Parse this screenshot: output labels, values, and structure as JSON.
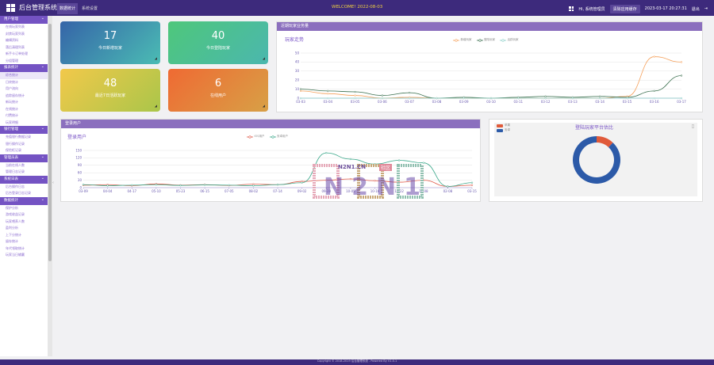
{
  "topbar": {
    "app_title": "后台管理系统",
    "tabs": [
      "数据统计",
      "系统设置"
    ],
    "welcome": "WELCOME! 2022-08-03",
    "user": "Hi, 系统管理员",
    "clear_cache": "清除应用缓存",
    "datetime": "2023-03-17 20:27:31",
    "logout": "退出"
  },
  "sidebar": [
    {
      "group": "用户管理",
      "items": [
        "在线玩家列表",
        "封禁玩家列表",
        "编辑资料",
        "落后清理列表",
        "新手卡订单处理",
        "分组管理"
      ]
    },
    {
      "group": "报表统计",
      "items": [
        "综合统计",
        "日终统计",
        "用户流向",
        "追踪留存统计",
        "新玩统计",
        "在线统计",
        "付费统计",
        "玩家明细"
      ]
    },
    {
      "group": "银行管理",
      "items": [
        "充值银行数据记录",
        "银行操作记录",
        "保险柜记录"
      ]
    },
    {
      "group": "管理员表",
      "items": [
        "当前在线人数",
        "管理日志记录"
      ]
    },
    {
      "group": "系统日表",
      "items": [
        "后台操作日志",
        "后台登录日志记录"
      ]
    },
    {
      "group": "数据统计",
      "items": [
        "保护分析",
        "游戏收益记录",
        "玩家喂养人数",
        "盈利分析",
        "上下分统计",
        "留存统计",
        "年代领取统计",
        "玩家当日输赢"
      ]
    }
  ],
  "stats": [
    {
      "value": "17",
      "label": "今日新增玩家",
      "from": "#3564a8",
      "to": "#4bbcb4"
    },
    {
      "value": "40",
      "label": "今日登陆玩家",
      "from": "#4ec77b",
      "to": "#4bb7ae"
    },
    {
      "value": "48",
      "label": "最近7日活跃玩家",
      "from": "#f2c84a",
      "to": "#aac64a"
    },
    {
      "value": "6",
      "label": "在线用户",
      "from": "#ef6a33",
      "to": "#d8a046"
    }
  ],
  "business": {
    "header": "近期玩家业务量",
    "title": "玩家走势",
    "legend": [
      {
        "name": "新增玩家",
        "color": "#f5a05a"
      },
      {
        "name": "登陆玩家",
        "color": "#3a6f4e"
      },
      {
        "name": "活跃玩家",
        "color": "#8ad0c8"
      }
    ]
  },
  "login_panel": {
    "header": "登录用户",
    "title": "登录用户",
    "legend": [
      {
        "name": "IOS用户",
        "color": "#e05a4a"
      },
      {
        "name": "安卓用户",
        "color": "#3aa88a"
      }
    ]
  },
  "platform": {
    "title": "登陆玩家平台估比",
    "legend": [
      {
        "name": "苹果",
        "color": "#e05a3a"
      },
      {
        "name": "安卓",
        "color": "#2c5aa8"
      }
    ],
    "ios_share": 0.12,
    "android_share": 0.88
  },
  "watermark": {
    "text": "N2N1.CN",
    "badge": "社区",
    "big": "N2N1"
  },
  "footer": "Copyright © 2018-2019 后台管理系统 - Powered By V1.0.1",
  "chart_data": [
    {
      "type": "line",
      "title": "玩家走势",
      "categories": [
        "03-03",
        "03-04",
        "03-05",
        "03-06",
        "03-07",
        "03-08",
        "03-09",
        "03-10",
        "03-11",
        "03-12",
        "03-13",
        "03-14",
        "03-15",
        "03-16",
        "03-17"
      ],
      "ylim": [
        0,
        50
      ],
      "yticks": [
        0,
        10,
        20,
        30,
        40,
        50
      ],
      "series": [
        {
          "name": "新增玩家",
          "color": "#f5a05a",
          "values": [
            8,
            5,
            3,
            0,
            1,
            0,
            0,
            0,
            0,
            0,
            0,
            0,
            2,
            46,
            40
          ]
        },
        {
          "name": "登陆玩家",
          "color": "#3a6f4e",
          "values": [
            10,
            8,
            7,
            3,
            6,
            0,
            1,
            0,
            1,
            2,
            1,
            2,
            1,
            8,
            25
          ]
        },
        {
          "name": "活跃玩家",
          "color": "#8ad0c8",
          "values": [
            0,
            0,
            0,
            0,
            0,
            0,
            0,
            0,
            0,
            0,
            0,
            0,
            0,
            0,
            0
          ]
        }
      ]
    },
    {
      "type": "line",
      "title": "登录用户",
      "categories": [
        "03-09",
        "04-04",
        "04-17",
        "05-10",
        "05-23",
        "06-15",
        "07-05",
        "08-02",
        "07-14",
        "09-02",
        "09-28",
        "10-05",
        "10-16",
        "10-22",
        "11-08",
        "02-08",
        "03-15"
      ],
      "ylim": [
        0,
        150
      ],
      "yticks": [
        0,
        30,
        60,
        90,
        120,
        150
      ],
      "series": [
        {
          "name": "IOS用户",
          "color": "#e05a4a",
          "values": [
            10,
            12,
            8,
            15,
            10,
            12,
            9,
            14,
            12,
            25,
            30,
            35,
            28,
            22,
            30,
            5,
            10
          ]
        },
        {
          "name": "安卓用户",
          "color": "#3aa88a",
          "values": [
            12,
            8,
            10,
            12,
            9,
            11,
            10,
            8,
            12,
            20,
            140,
            115,
            95,
            110,
            100,
            5,
            20
          ]
        }
      ]
    },
    {
      "type": "pie",
      "title": "登陆玩家平台估比",
      "categories": [
        "苹果",
        "安卓"
      ],
      "values": [
        12,
        88
      ]
    }
  ]
}
